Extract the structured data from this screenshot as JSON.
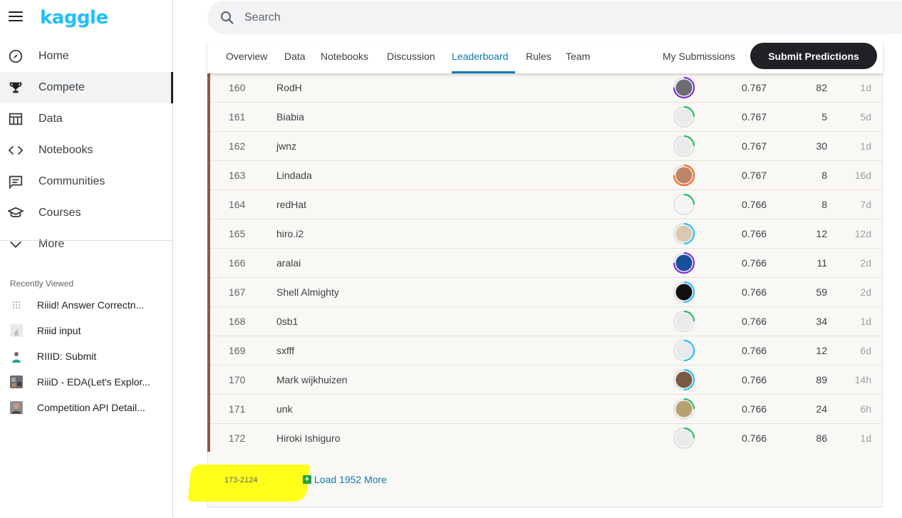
{
  "brand": {
    "logo": "kaggle"
  },
  "nav": [
    {
      "label": "Home",
      "icon": "compass-icon"
    },
    {
      "label": "Compete",
      "icon": "trophy-icon",
      "active": true
    },
    {
      "label": "Data",
      "icon": "table-icon"
    },
    {
      "label": "Notebooks",
      "icon": "code-icon"
    },
    {
      "label": "Communities",
      "icon": "chat-icon"
    },
    {
      "label": "Courses",
      "icon": "graduation-cap-icon"
    },
    {
      "label": "More",
      "icon": "chevron-down-icon"
    }
  ],
  "recent": {
    "title": "Recently Viewed",
    "items": [
      {
        "label": "Riiid! Answer Correctn..."
      },
      {
        "label": "Riiid input"
      },
      {
        "label": "RIIID: Submit"
      },
      {
        "label": "RiiiD - EDA(Let's Explor..."
      },
      {
        "label": "Competition API Detail..."
      }
    ]
  },
  "search": {
    "placeholder": "Search"
  },
  "tabs": [
    {
      "label": "Overview"
    },
    {
      "label": "Data"
    },
    {
      "label": "Notebooks"
    },
    {
      "label": "Discussion"
    },
    {
      "label": "Leaderboard",
      "active": true
    },
    {
      "label": "Rules"
    },
    {
      "label": "Team"
    }
  ],
  "actions": {
    "my_submissions": "My Submissions",
    "submit": "Submit Predictions"
  },
  "leaderboard": {
    "rows": [
      {
        "rank": "160",
        "team": "RodH",
        "score": "0.767",
        "entries": "82",
        "last": "1d"
      },
      {
        "rank": "161",
        "team": "Biabia",
        "score": "0.767",
        "entries": "5",
        "last": "5d"
      },
      {
        "rank": "162",
        "team": "jwnz",
        "score": "0.767",
        "entries": "30",
        "last": "1d"
      },
      {
        "rank": "163",
        "team": "Lindada",
        "score": "0.767",
        "entries": "8",
        "last": "16d"
      },
      {
        "rank": "164",
        "team": "redHat",
        "score": "0.766",
        "entries": "8",
        "last": "7d"
      },
      {
        "rank": "165",
        "team": "hiro.i2",
        "score": "0.766",
        "entries": "12",
        "last": "12d"
      },
      {
        "rank": "166",
        "team": "aralai",
        "score": "0.766",
        "entries": "11",
        "last": "2d"
      },
      {
        "rank": "167",
        "team": "Shell Almighty",
        "score": "0.766",
        "entries": "59",
        "last": "2d"
      },
      {
        "rank": "168",
        "team": "0sb1",
        "score": "0.766",
        "entries": "34",
        "last": "1d"
      },
      {
        "rank": "169",
        "team": "sxfff",
        "score": "0.766",
        "entries": "12",
        "last": "6d"
      },
      {
        "rank": "170",
        "team": "Mark wijkhuizen",
        "score": "0.766",
        "entries": "89",
        "last": "14h"
      },
      {
        "rank": "171",
        "team": "unk",
        "score": "0.766",
        "entries": "24",
        "last": "6h"
      },
      {
        "rank": "172",
        "team": "Hiroki Ishiguro",
        "score": "0.766",
        "entries": "86",
        "last": "1d"
      }
    ],
    "range": "173-2124",
    "load_more": "Load 1952 More"
  },
  "colors": {
    "brand": "#20beff",
    "accent": "#0c7bb3",
    "medal_bronze_bar": "#8a5a44",
    "tier_novice": "#20be5f",
    "tier_contributor": "#20beff",
    "tier_expert": "#7b2fdc",
    "tier_master": "#f96517"
  }
}
